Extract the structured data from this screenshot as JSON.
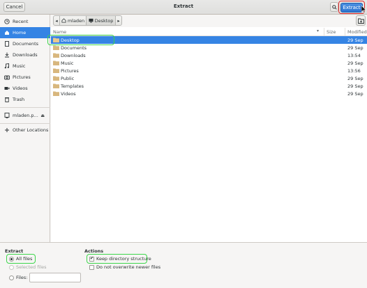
{
  "header": {
    "cancel_label": "Cancel",
    "title": "Extract",
    "extract_label": "Extract"
  },
  "sidebar": {
    "items": [
      {
        "label": "Recent",
        "icon": "clock-icon"
      },
      {
        "label": "Home",
        "icon": "home-icon"
      },
      {
        "label": "Documents",
        "icon": "document-icon"
      },
      {
        "label": "Downloads",
        "icon": "download-icon"
      },
      {
        "label": "Music",
        "icon": "music-icon"
      },
      {
        "label": "Pictures",
        "icon": "camera-icon"
      },
      {
        "label": "Videos",
        "icon": "video-icon"
      },
      {
        "label": "Trash",
        "icon": "trash-icon"
      },
      {
        "label": "mladen.p...",
        "icon": "drive-icon"
      },
      {
        "label": "Other Locations",
        "icon": "plus-icon"
      }
    ],
    "active": "Home"
  },
  "pathbar": {
    "home_label": "mladen",
    "current_label": "Desktop"
  },
  "filelist": {
    "columns": {
      "name": "Name",
      "size": "Size",
      "modified": "Modified"
    },
    "rows": [
      {
        "name": "Desktop",
        "modified": "29 Sep"
      },
      {
        "name": "Documents",
        "modified": "29 Sep"
      },
      {
        "name": "Downloads",
        "modified": "13:54"
      },
      {
        "name": "Music",
        "modified": "29 Sep"
      },
      {
        "name": "Pictures",
        "modified": "13:56"
      },
      {
        "name": "Public",
        "modified": "29 Sep"
      },
      {
        "name": "Templates",
        "modified": "29 Sep"
      },
      {
        "name": "Videos",
        "modified": "29 Sep"
      }
    ],
    "selected": "Desktop"
  },
  "options": {
    "extract_title": "Extract",
    "all_files": "All files",
    "selected_files": "Selected files",
    "files": "Files:",
    "actions_title": "Actions",
    "keep_structure": "Keep directory structure",
    "no_overwrite": "Do not overwrite newer files"
  },
  "colors": {
    "accent": "#3584e4",
    "highlight": "#3cd64a",
    "extract_outline": "#e0282a"
  }
}
